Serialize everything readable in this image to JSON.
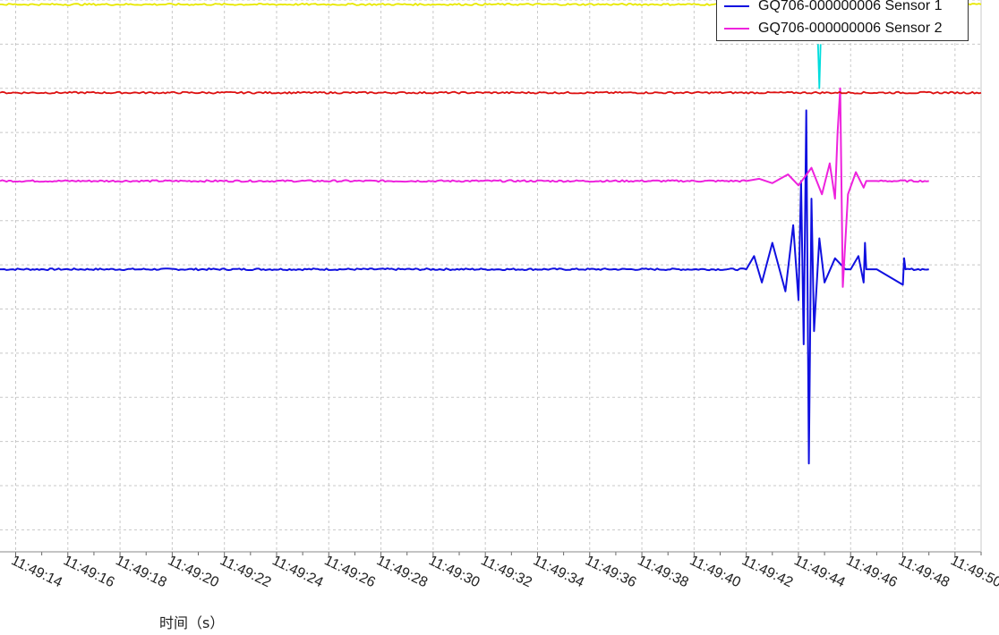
{
  "chart_data": {
    "type": "line",
    "xlabel": "时间（s）",
    "ylabel": "",
    "x_ticks": [
      "11:49:14",
      "11:49:16",
      "11:49:18",
      "11:49:20",
      "11:49:22",
      "11:49:24",
      "11:49:26",
      "11:49:28",
      "11:49:30",
      "11:49:32",
      "11:49:34",
      "11:49:36",
      "11:49:38",
      "11:49:40",
      "11:49:42",
      "11:49:44",
      "11:49:46",
      "11:49:48",
      "11:49:50"
    ],
    "xlim": [
      "11:49:13.4",
      "11:49:51"
    ],
    "grid": true,
    "legend_position": "top-right",
    "series": [
      {
        "name": "GQ706-000000006 Sensor 1",
        "color": "#1010e0",
        "baseline": -0.1,
        "x": [
          "11:49:13.4",
          "11:49:32",
          "11:49:42.0",
          "11:49:42.3",
          "11:49:42.6",
          "11:49:43.0",
          "11:49:43.5",
          "11:49:43.8",
          "11:49:44.0",
          "11:49:44.1",
          "11:49:44.2",
          "11:49:44.3",
          "11:49:44.4",
          "11:49:44.5",
          "11:49:44.6",
          "11:49:44.8",
          "11:49:45.0",
          "11:49:45.4",
          "11:49:45.8",
          "11:49:46.0",
          "11:49:46.3",
          "11:49:46.5",
          "11:49:46.55",
          "11:49:46.6",
          "11:49:47.0",
          "11:49:48.0",
          "11:49:48.05",
          "11:49:48.1",
          "11:49:49.0"
        ],
        "values": [
          -0.1,
          -0.1,
          -0.1,
          0.2,
          -0.4,
          0.5,
          -0.6,
          0.9,
          -0.8,
          1.9,
          -1.8,
          3.5,
          -4.5,
          1.5,
          -1.5,
          0.6,
          -0.4,
          0.15,
          -0.1,
          -0.1,
          0.2,
          -0.4,
          0.5,
          -0.1,
          -0.1,
          -0.45,
          0.15,
          -0.1,
          -0.1
        ]
      },
      {
        "name": "GQ706-000000006 Sensor 2",
        "color": "#ee22dd",
        "baseline": 1.9,
        "x": [
          "11:49:13.4",
          "11:49:42.0",
          "11:49:42.5",
          "11:49:43.0",
          "11:49:43.6",
          "11:49:44.0",
          "11:49:44.5",
          "11:49:44.9",
          "11:49:45.2",
          "11:49:45.4",
          "11:49:45.5",
          "11:49:45.6",
          "11:49:45.7",
          "11:49:45.9",
          "11:49:46.2",
          "11:49:46.5",
          "11:49:46.6",
          "11:49:47.0",
          "11:49:49.0"
        ],
        "values": [
          1.9,
          1.9,
          1.95,
          1.85,
          2.05,
          1.8,
          2.2,
          1.6,
          2.3,
          1.5,
          3.0,
          4.0,
          -0.5,
          1.6,
          2.1,
          1.75,
          1.9,
          1.9,
          1.9
        ]
      },
      {
        "name": "",
        "color": "#dd1111",
        "baseline": 3.9,
        "x": [
          "11:49:13.4",
          "11:49:51"
        ],
        "values": [
          3.9,
          3.9
        ]
      },
      {
        "name": "",
        "color": "#00dddd",
        "baseline": 4.0,
        "x": [
          "11:49:44.75",
          "11:49:44.8",
          "11:49:44.85"
        ],
        "values": [
          5.0,
          4.0,
          5.0
        ]
      },
      {
        "name": "",
        "color": "#e8e800",
        "baseline": 5.9,
        "x": [
          "11:49:13.4",
          "11:49:51"
        ],
        "values": [
          5.9,
          5.9
        ]
      }
    ],
    "ylim": [
      -6.5,
      6.0
    ]
  }
}
